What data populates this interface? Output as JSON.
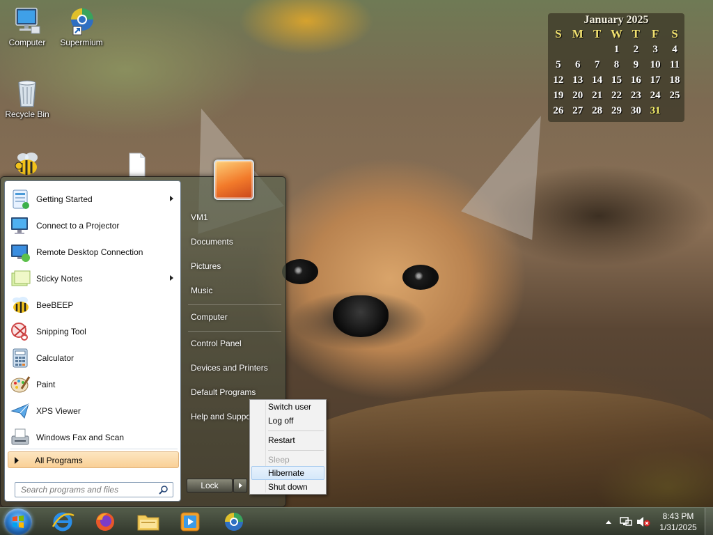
{
  "desktop": {
    "icons": [
      {
        "label": "Computer",
        "icon": "computer-icon"
      },
      {
        "label": "Supermium",
        "icon": "supermium-icon"
      },
      {
        "label": "Recycle Bin",
        "icon": "recycle-bin-icon"
      },
      {
        "label": "",
        "icon": "beebeep-icon"
      },
      {
        "label": "",
        "icon": "file-icon"
      }
    ]
  },
  "calendar": {
    "title": "January 2025",
    "weekdays": [
      "S",
      "M",
      "T",
      "W",
      "T",
      "F",
      "S"
    ],
    "weeks": [
      [
        "",
        "",
        "",
        "1",
        "2",
        "3",
        "4"
      ],
      [
        "5",
        "6",
        "7",
        "8",
        "9",
        "10",
        "11"
      ],
      [
        "12",
        "13",
        "14",
        "15",
        "16",
        "17",
        "18"
      ],
      [
        "19",
        "20",
        "21",
        "22",
        "23",
        "24",
        "25"
      ],
      [
        "26",
        "27",
        "28",
        "29",
        "30",
        "31",
        ""
      ]
    ],
    "today": "31",
    "today_color": "#f5f069"
  },
  "start_menu": {
    "programs": [
      {
        "label": "Getting Started",
        "icon": "getting-started-icon",
        "has_submenu": true
      },
      {
        "label": "Connect to a Projector",
        "icon": "projector-icon",
        "has_submenu": false
      },
      {
        "label": "Remote Desktop Connection",
        "icon": "remote-desktop-icon",
        "has_submenu": false
      },
      {
        "label": "Sticky Notes",
        "icon": "sticky-notes-icon",
        "has_submenu": true
      },
      {
        "label": "BeeBEEP",
        "icon": "beebeep-icon",
        "has_submenu": false
      },
      {
        "label": "Snipping Tool",
        "icon": "snipping-tool-icon",
        "has_submenu": false
      },
      {
        "label": "Calculator",
        "icon": "calculator-icon",
        "has_submenu": false
      },
      {
        "label": "Paint",
        "icon": "paint-icon",
        "has_submenu": false
      },
      {
        "label": "XPS Viewer",
        "icon": "xps-viewer-icon",
        "has_submenu": false
      },
      {
        "label": "Windows Fax and Scan",
        "icon": "fax-scan-icon",
        "has_submenu": false
      }
    ],
    "all_programs_label": "All Programs",
    "search_placeholder": "Search programs and files",
    "right_items": [
      {
        "label": "VM1"
      },
      {
        "label": "Documents"
      },
      {
        "label": "Pictures"
      },
      {
        "label": "Music"
      },
      {
        "label": "Computer"
      },
      {
        "label": "Control Panel"
      },
      {
        "label": "Devices and Printers"
      },
      {
        "label": "Default Programs"
      },
      {
        "label": "Help and Support"
      }
    ],
    "lock_label": "Lock"
  },
  "power_menu": {
    "items": [
      {
        "label": "Switch user",
        "enabled": true
      },
      {
        "label": "Log off",
        "enabled": true
      },
      {
        "label": "Restart",
        "enabled": true
      },
      {
        "label": "Sleep",
        "enabled": false
      },
      {
        "label": "Hibernate",
        "enabled": true,
        "highlighted": true
      },
      {
        "label": "Shut down",
        "enabled": true
      }
    ]
  },
  "taskbar": {
    "pinned": [
      {
        "icon": "internet-explorer-icon"
      },
      {
        "icon": "firefox-icon"
      },
      {
        "icon": "file-explorer-icon"
      },
      {
        "icon": "media-player-icon"
      },
      {
        "icon": "supermium-icon"
      }
    ],
    "clock": {
      "time": "8:43 PM",
      "date": "1/31/2025"
    }
  },
  "colors": {
    "all_programs_bg": "#f9cf96",
    "hover_bg": "#d6e8fa",
    "accent": "#2a7fd4"
  }
}
